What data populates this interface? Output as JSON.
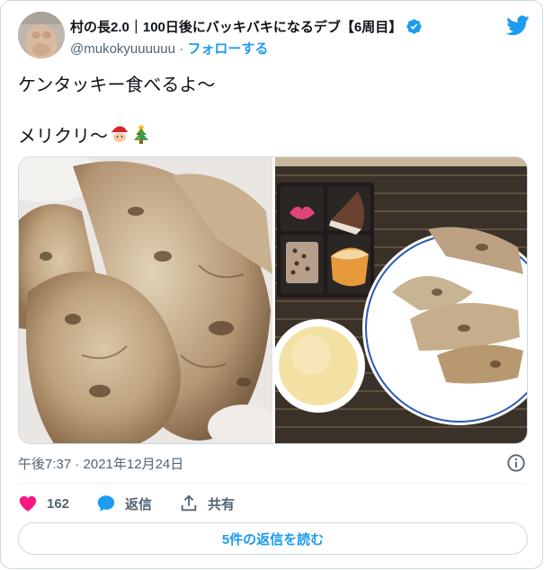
{
  "tweet": {
    "display_name": "村の長2.0｜100日後にバッキバキになるデブ【6周目】",
    "handle": "@mukokyuuuuuu",
    "separator": "·",
    "follow_label": "フォローする",
    "text_lines": [
      "ケンタッキー食べるよ〜",
      "",
      "メリクリ〜"
    ],
    "timestamp": "午後7:37 · 2021年12月24日",
    "like_count": "162",
    "reply_label": "返信",
    "share_label": "共有",
    "view_replies_label": "5件の返信を読む"
  },
  "icons": {
    "verified": "verified-badge-icon",
    "brand": "twitter-bird-icon",
    "info": "info-icon",
    "like": "heart-icon",
    "reply": "speech-bubble-icon",
    "share": "share-upload-icon",
    "emoji_1": "santa-emoji-icon",
    "emoji_2": "christmas-tree-emoji-icon"
  },
  "colors": {
    "accent": "#1d9bf0",
    "like": "#f91880",
    "text": "#0f1419",
    "secondary": "#536471",
    "border": "#cfd9de"
  }
}
